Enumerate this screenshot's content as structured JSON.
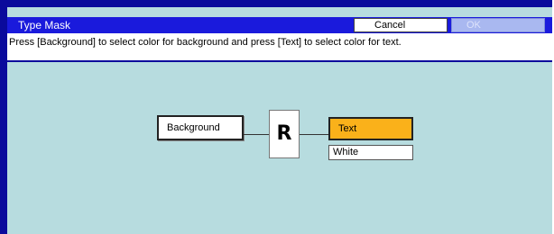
{
  "title": "Type Mask",
  "buttons": {
    "cancel": "Cancel",
    "ok": "OK"
  },
  "instruction": "Press [Background] to select color for background and press [Text] to select color for text.",
  "mask": {
    "background_label": "Background",
    "preview_letter": "R",
    "text_label": "Text",
    "text_color_value": "White"
  },
  "colors": {
    "frame": "#0a0a9c",
    "titlebar": "#1a1adc",
    "panel": "#b7dcdf",
    "text_button_active": "#fab11a",
    "ok_disabled": "#a9b8f0"
  }
}
